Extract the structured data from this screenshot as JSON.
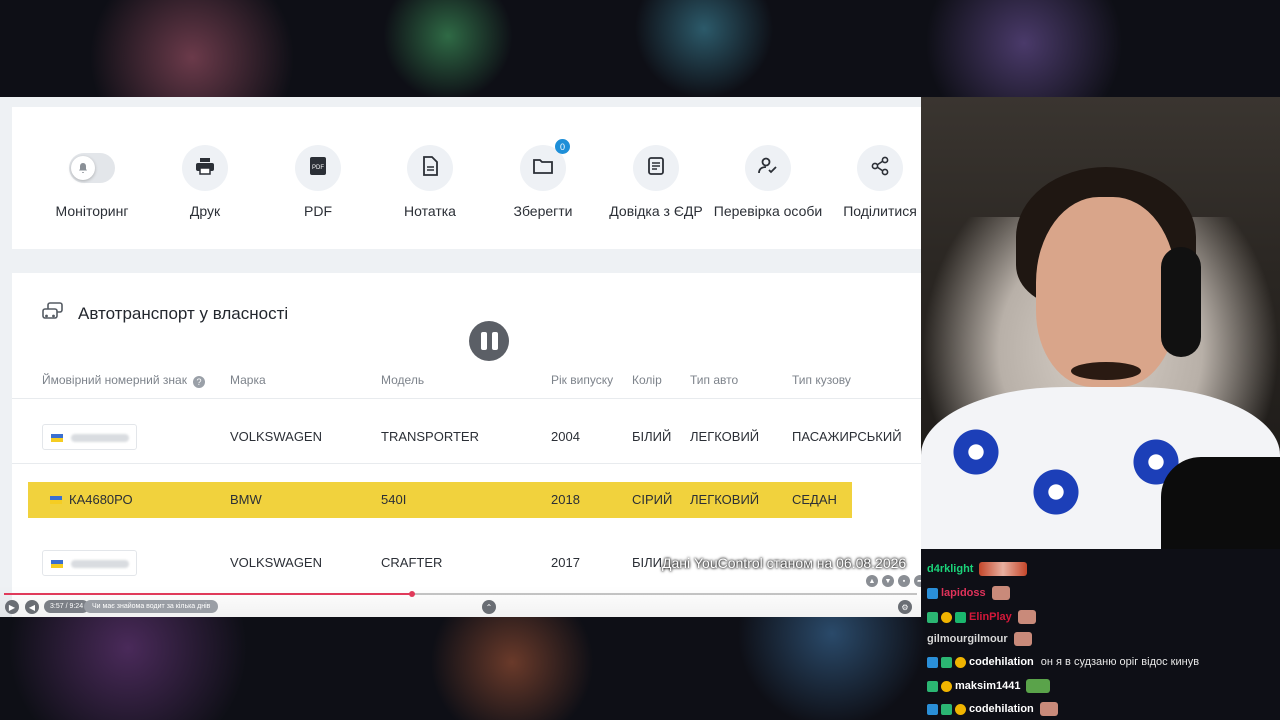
{
  "toolbar": {
    "items": [
      {
        "label": "Моніторинг",
        "icon": "bell-toggle-icon"
      },
      {
        "label": "Друк",
        "icon": "print-icon"
      },
      {
        "label": "PDF",
        "icon": "pdf-icon"
      },
      {
        "label": "Нотатка",
        "icon": "note-icon"
      },
      {
        "label": "Зберегти",
        "icon": "folder-icon",
        "badge": "0"
      },
      {
        "label": "Довідка з ЄДР",
        "icon": "document-icon"
      },
      {
        "label": "Перевірка особи",
        "icon": "person-check-icon"
      },
      {
        "label": "Поділитися",
        "icon": "share-icon"
      }
    ]
  },
  "vehicles": {
    "title": "Автотранспорт у власності",
    "columns": {
      "plate": "Ймовірний номерний знак",
      "brand": "Марка",
      "model": "Модель",
      "year": "Рік випуску",
      "color": "Колір",
      "type": "Тип авто",
      "body": "Тип кузову"
    },
    "rows": [
      {
        "plate": "",
        "brand": "VOLKSWAGEN",
        "model": "TRANSPORTER",
        "year": "2004",
        "color": "БІЛИЙ",
        "type": "ЛЕГКОВИЙ",
        "body": "ПАСАЖИРСЬКИЙ",
        "highlighted": false
      },
      {
        "plate": "КА4680РО",
        "brand": "BMW",
        "model": "540I",
        "year": "2018",
        "color": "СІРИЙ",
        "type": "ЛЕГКОВИЙ",
        "body": "СЕДАН",
        "highlighted": true
      },
      {
        "plate": "",
        "brand": "VOLKSWAGEN",
        "model": "CRAFTER",
        "year": "2017",
        "color": "БІЛИ",
        "type": "",
        "body": "",
        "highlighted": false
      }
    ]
  },
  "video": {
    "caption": "Дані YouControl станом на 06.08.2026",
    "time": "3:57 / 9:24",
    "chapter": "Чи має знайома водит за кілька днів",
    "progress_fraction": 0.447
  },
  "chat": {
    "messages": [
      {
        "user": "d4rklight",
        "color": "#1bd47a",
        "text": ""
      },
      {
        "user": "lapidoss",
        "color": "#e0325a",
        "text": ""
      },
      {
        "user": "ElinPlay",
        "color": "#d4183a",
        "text": ""
      },
      {
        "user": "gilmourgilmour",
        "color": "#d8d8d8",
        "text": ""
      },
      {
        "user": "codehilation",
        "color": "#ffffff",
        "text": "он я в судзаню оріг відос кинув"
      },
      {
        "user": "maksim1441",
        "color": "#ffffff",
        "text": ""
      },
      {
        "user": "codehilation",
        "color": "#ffffff",
        "text": ""
      }
    ]
  },
  "colors": {
    "highlight": "#f1d23d",
    "progress": "#e03a5a",
    "badge": "#1e8fd8"
  }
}
